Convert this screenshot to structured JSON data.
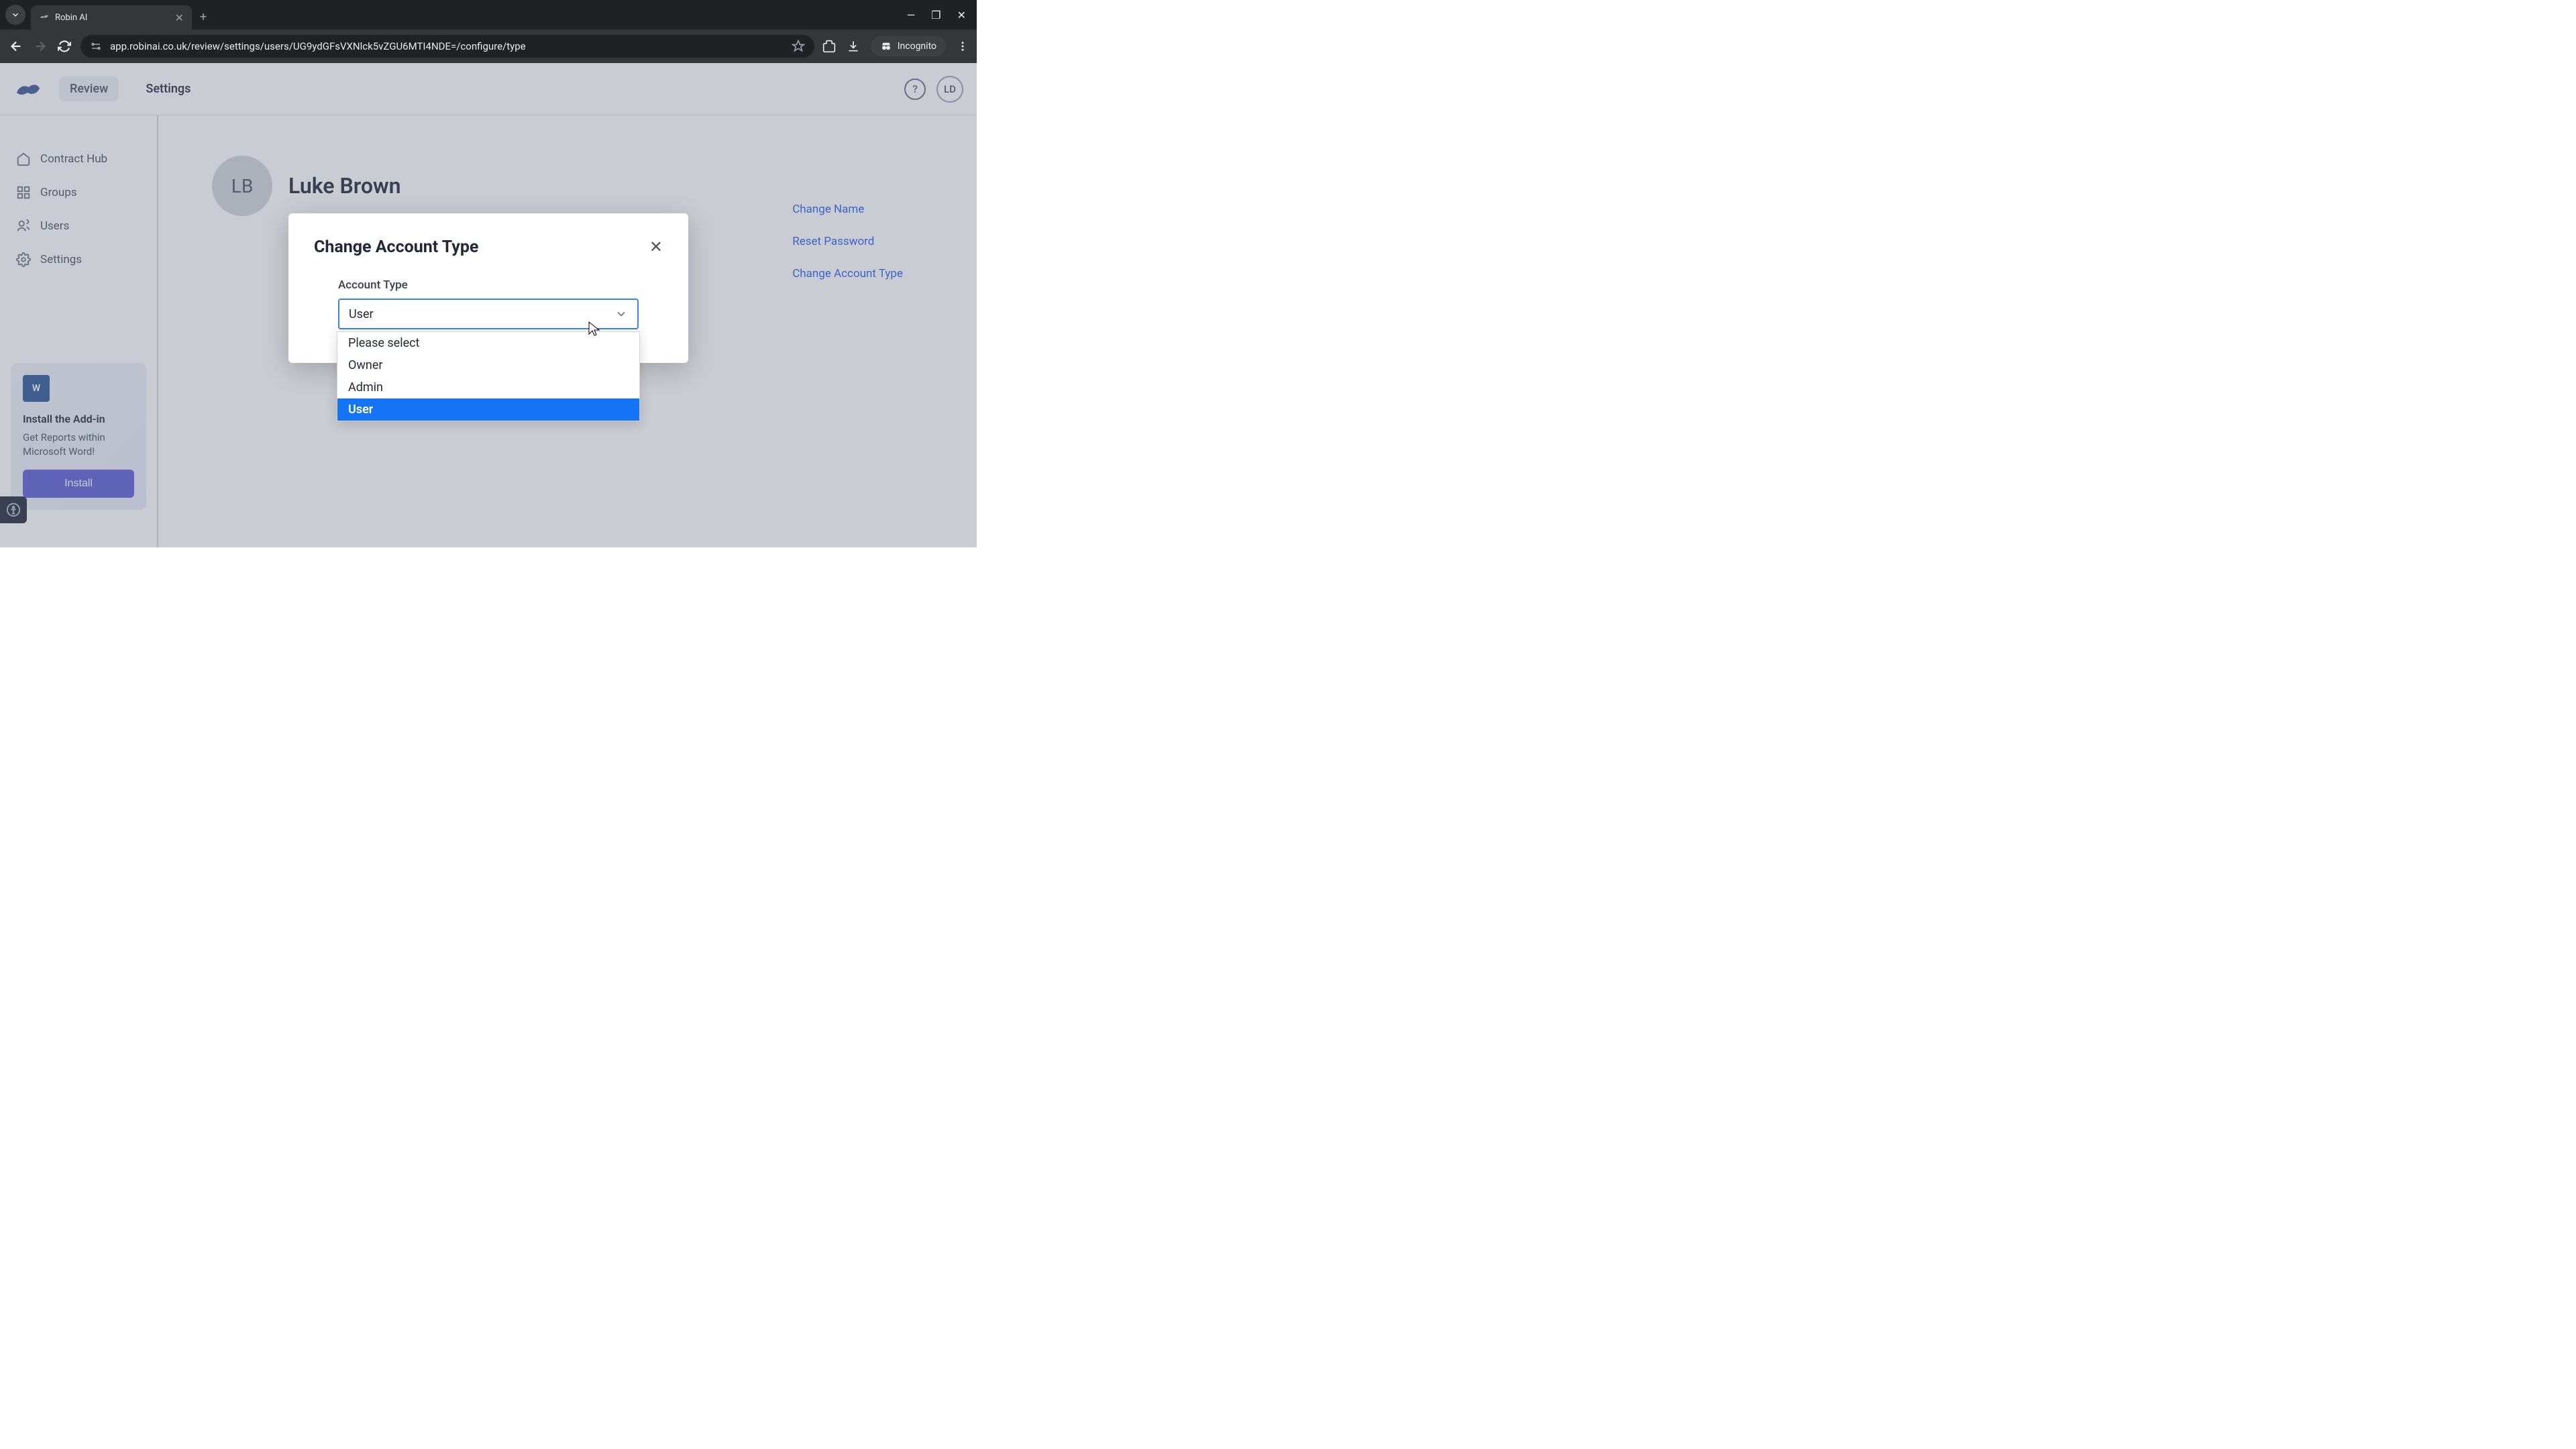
{
  "browser": {
    "tab_title": "Robin AI",
    "url": "app.robinai.co.uk/review/settings/users/UG9ydGFsVXNlck5vZGU6MTI4NDE=/configure/type",
    "incognito_label": "Incognito"
  },
  "header": {
    "nav": {
      "review": "Review",
      "settings": "Settings"
    },
    "user_initials": "LD"
  },
  "sidebar": {
    "items": [
      {
        "label": "Contract Hub"
      },
      {
        "label": "Groups"
      },
      {
        "label": "Users"
      },
      {
        "label": "Settings"
      }
    ],
    "addin": {
      "icon_label": "W",
      "title": "Install the Add-in",
      "description": "Get Reports within Microsoft Word!",
      "button": "Install"
    }
  },
  "content": {
    "user_initials": "LB",
    "user_name": "Luke Brown",
    "actions": {
      "change_name": "Change Name",
      "reset_password": "Reset Password",
      "change_account_type": "Change Account Type"
    }
  },
  "modal": {
    "title": "Change Account Type",
    "field_label": "Account Type",
    "selected": "User"
  },
  "dropdown": {
    "options": [
      {
        "label": "Please select",
        "selected": false
      },
      {
        "label": "Owner",
        "selected": false
      },
      {
        "label": "Admin",
        "selected": false
      },
      {
        "label": "User",
        "selected": true
      }
    ]
  }
}
